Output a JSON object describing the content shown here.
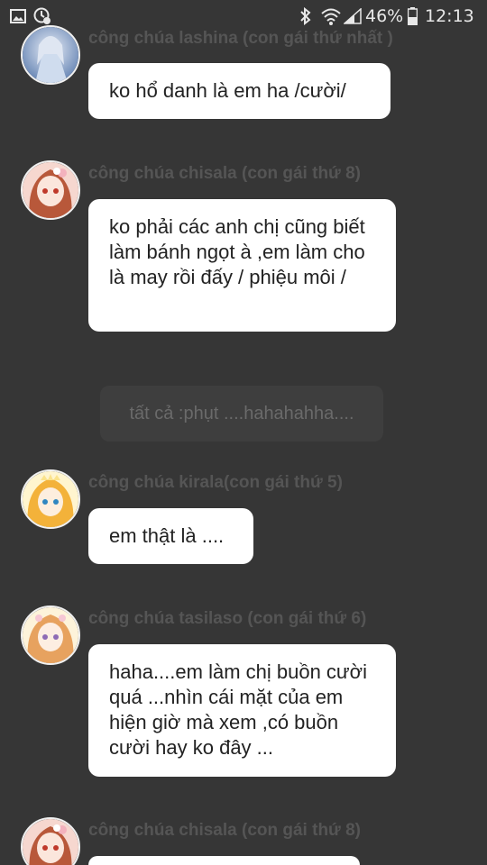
{
  "status_bar": {
    "left_icons": [
      "image-icon",
      "notification-icon"
    ],
    "right_icons": [
      "bluetooth-icon",
      "wifi-icon",
      "signal-icon",
      "battery-icon"
    ],
    "battery_percent": "46%",
    "time": "12:13"
  },
  "messages": [
    {
      "sender": "công chúa lashina (con gái thứ nhất )",
      "text": "ko hổ danh là em ha /cười/",
      "avatar_palette": [
        "#9fb6d8",
        "#e9eef7",
        "#5f7fb0"
      ]
    },
    {
      "sender": "công chúa chisala (con gái thứ 8)",
      "text": "ko phải các anh chị cũng biết làm bánh ngọt à ,em làm cho là may rồi đấy / phiệu môi /",
      "avatar_palette": [
        "#f6d7cf",
        "#b8583a",
        "#f3b2bd"
      ]
    },
    {
      "system_text": "tất cả :phụt ....hahahahha...."
    },
    {
      "sender": "công chúa kirala(con gái thứ 5)",
      "text": "em thật là ....",
      "avatar_palette": [
        "#fbe38c",
        "#f3b23a",
        "#fff5cf"
      ]
    },
    {
      "sender": "công chúa tasilaso (con gái thứ 6)",
      "text": "haha....em làm chị buồn cười quá ...nhìn cái mặt của em hiện giờ mà xem ,có buồn cười hay ko đây ...",
      "avatar_palette": [
        "#fdf3da",
        "#e7a25f",
        "#f6c7d4"
      ]
    },
    {
      "sender": "công chúa chisala (con gái thứ 8)",
      "text": "",
      "avatar_palette": [
        "#f6d7cf",
        "#b8583a",
        "#f3b2bd"
      ]
    }
  ]
}
